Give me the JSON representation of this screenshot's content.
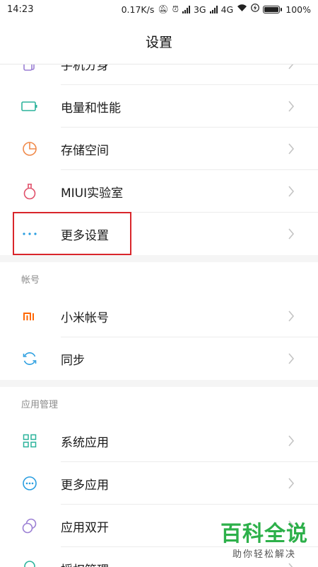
{
  "status_bar": {
    "time": "14:23",
    "speed": "0.17K/s",
    "net1": "3G",
    "net2": "4G",
    "battery": "100%"
  },
  "header": {
    "title": "设置"
  },
  "items_top": [
    {
      "label": "手机分身",
      "icon": "phone-clone-icon",
      "color": "#9b7fd4"
    },
    {
      "label": "电量和性能",
      "icon": "battery-outline-icon",
      "color": "#2bb39b"
    },
    {
      "label": "存储空间",
      "icon": "pie-chart-icon",
      "color": "#f08a4b"
    },
    {
      "label": "MIUI实验室",
      "icon": "flask-icon",
      "color": "#e0506a"
    },
    {
      "label": "更多设置",
      "icon": "more-dots-icon",
      "color": "#2a9ee0"
    }
  ],
  "section_account": {
    "title": "帐号"
  },
  "items_account": [
    {
      "label": "小米帐号",
      "icon": "mi-logo-icon",
      "color": "#ff6700"
    },
    {
      "label": "同步",
      "icon": "sync-icon",
      "color": "#2a9ee0"
    }
  ],
  "section_apps": {
    "title": "应用管理"
  },
  "items_apps": [
    {
      "label": "系统应用",
      "icon": "grid-icon",
      "color": "#2bb39b"
    },
    {
      "label": "更多应用",
      "icon": "more-circle-icon",
      "color": "#2a9ee0"
    },
    {
      "label": "应用双开",
      "icon": "dual-circle-icon",
      "color": "#9b7fd4"
    },
    {
      "label": "授权管理",
      "icon": "badge-icon",
      "color": "#2bb39b"
    }
  ],
  "watermark": {
    "main": "百科全说",
    "sub": "助你轻松解决"
  }
}
